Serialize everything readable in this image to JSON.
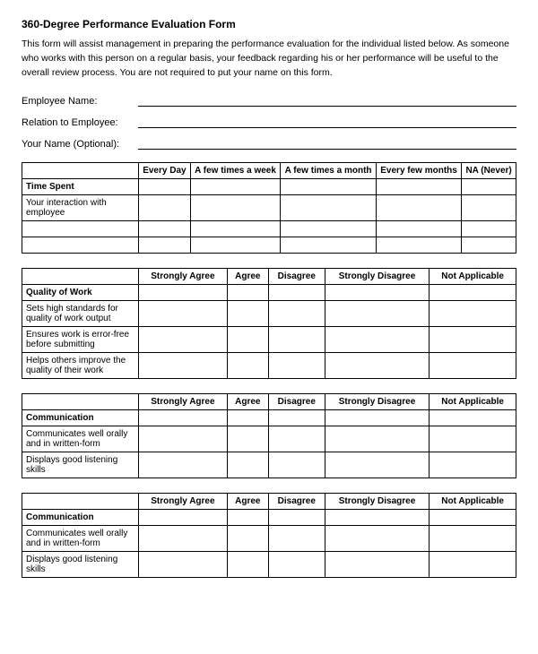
{
  "title": "360-Degree Performance Evaluation Form",
  "intro": "This form will assist management in preparing the performance evaluation for the individual listed below. As someone who works with this person on a regular basis, your feedback regarding his or her performance will be useful to the overall review process.  You are not required to put your name on this form.",
  "fields": {
    "employee_name_label": "Employee Name:",
    "relation_label": "Relation to Employee:",
    "your_name_label": "Your Name (Optional):"
  },
  "time_spent_table": {
    "col_label": "Time Spent",
    "columns": [
      "Every Day",
      "A few times a week",
      "A few times a month",
      "Every few months",
      "NA (Never)"
    ],
    "rows": [
      "Your interaction with employee",
      "",
      ""
    ]
  },
  "quality_table": {
    "col_label": "Quality of Work",
    "columns": [
      "Strongly Agree",
      "Agree",
      "Disagree",
      "Strongly Disagree",
      "Not Applicable"
    ],
    "rows": [
      "Sets high standards for quality of work output",
      "Ensures work is error-free before submitting",
      "Helps others improve the quality of their work"
    ]
  },
  "communication_table_1": {
    "col_label": "Communication",
    "columns": [
      "Strongly Agree",
      "Agree",
      "Disagree",
      "Strongly Disagree",
      "Not Applicable"
    ],
    "rows": [
      "Communicates well orally and in written-form",
      "Displays good listening skills"
    ]
  },
  "communication_table_2": {
    "col_label": "Communication",
    "columns": [
      "Strongly Agree",
      "Agree",
      "Disagree",
      "Strongly Disagree",
      "Not Applicable"
    ],
    "rows": [
      "Communicates well orally and in written-form",
      "Displays good listening skills"
    ]
  }
}
